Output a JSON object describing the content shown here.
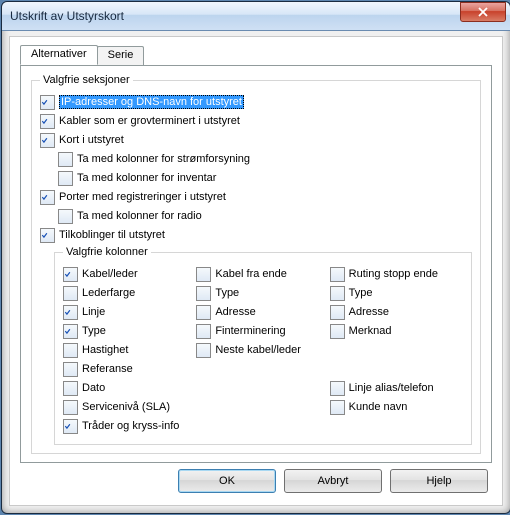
{
  "window": {
    "title": "Utskrift av Utstyrskort"
  },
  "tabs": {
    "t0": "Alternativer",
    "t1": "Serie"
  },
  "opt": {
    "legend": "Valgfrie seksjoner",
    "ip": "IP-adresser og DNS-navn for utstyret",
    "kabler": "Kabler som er grovterminert i utstyret",
    "kort": "Kort i utstyret",
    "kort_power": "Ta med kolonner for strømforsyning",
    "kort_inv": "Ta med kolonner for inventar",
    "porter": "Porter med registreringer i utstyret",
    "porter_radio": "Ta med kolonner for radio",
    "tilk": "Tilkoblinger til utstyret"
  },
  "cols": {
    "legend": "Valgfrie kolonner",
    "c1": {
      "kabel": "Kabel/leder",
      "lederfarge": "Lederfarge",
      "linje": "Linje",
      "type": "Type",
      "hastighet": "Hastighet",
      "referanse": "Referanse",
      "dato": "Dato",
      "sla": "Servicenivå (SLA)",
      "trader": "Tråder og kryss-info"
    },
    "c2": {
      "kabel_fra": "Kabel fra ende",
      "type": "Type",
      "adresse": "Adresse",
      "fint": "Finterminering",
      "neste": "Neste kabel/leder"
    },
    "c3": {
      "ruting": "Ruting stopp ende",
      "type": "Type",
      "adresse": "Adresse",
      "merknad": "Merknad",
      "alias": "Linje alias/telefon",
      "kunde": "Kunde navn"
    }
  },
  "buttons": {
    "ok": "OK",
    "cancel": "Avbryt",
    "help": "Hjelp"
  }
}
